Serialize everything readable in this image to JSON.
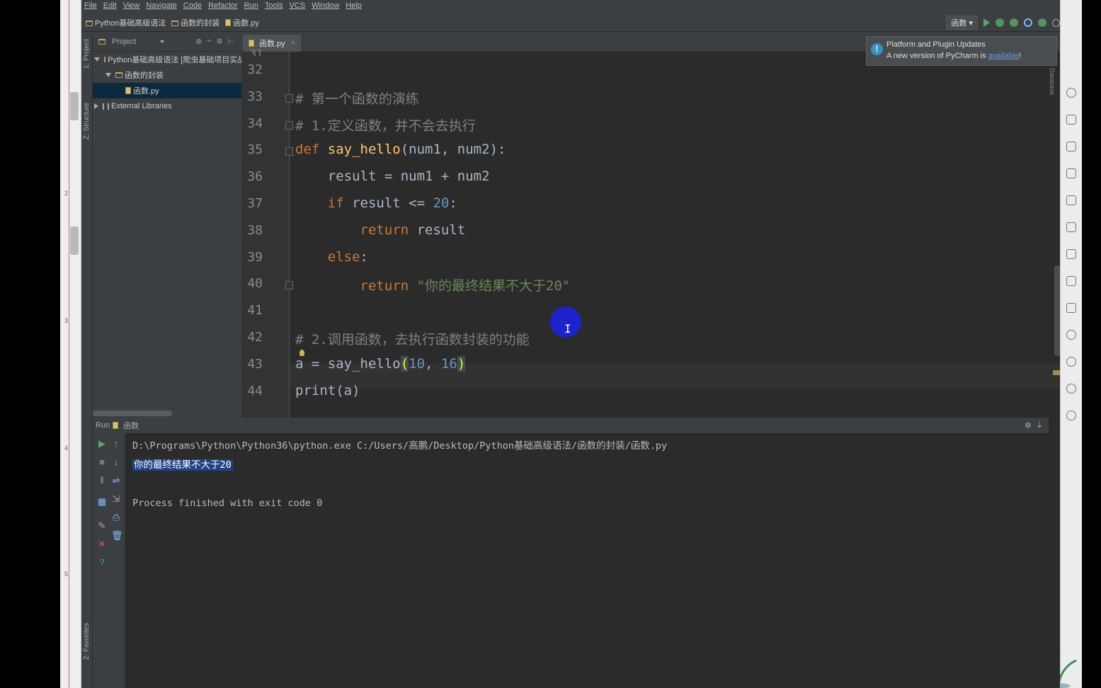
{
  "menu": [
    "File",
    "Edit",
    "View",
    "Navigate",
    "Code",
    "Refactor",
    "Run",
    "Tools",
    "VCS",
    "Window",
    "Help"
  ],
  "breadcrumb": [
    "Python基础高级语法",
    "函数的封装",
    "函数.py"
  ],
  "run_config": "函数",
  "left_strip_labels": [
    "1: Project",
    "Z: Structure",
    "2: Favorites"
  ],
  "project_panel": {
    "title": "Project",
    "tree": [
      {
        "label": "Python基础高级语法 [爬虫基础项目实战]",
        "level": 0,
        "type": "folder",
        "expanded": true
      },
      {
        "label": "函数的封装",
        "level": 1,
        "type": "folder",
        "expanded": true
      },
      {
        "label": "函数.py",
        "level": 2,
        "type": "file",
        "selected": true
      },
      {
        "label": "External Libraries",
        "level": 0,
        "type": "library",
        "expanded": false
      }
    ]
  },
  "editor": {
    "tab": "函数.py",
    "partial_top_line": "31",
    "lines": [
      {
        "n": "32",
        "html": ""
      },
      {
        "n": "33",
        "html": "<span class=\"cm\"># 第一个函数的演练</span>"
      },
      {
        "n": "34",
        "html": "<span class=\"cm\"># 1.定义函数，并不会去执行</span>"
      },
      {
        "n": "35",
        "html": "<span class=\"kw\">def</span> <span class=\"fn\">say_hello</span>(num1, num2):"
      },
      {
        "n": "36",
        "html": "    result = num1 + num2"
      },
      {
        "n": "37",
        "html": "    <span class=\"kw\">if</span> result &lt;= <span class=\"num\">20</span>:"
      },
      {
        "n": "38",
        "html": "        <span class=\"kw\">return</span> result"
      },
      {
        "n": "39",
        "html": "    <span class=\"kw\">else</span>:"
      },
      {
        "n": "40",
        "html": "        <span class=\"kw\">return</span> <span class=\"str\">\"你的最终结果不大于20\"</span>"
      },
      {
        "n": "41",
        "html": ""
      },
      {
        "n": "42",
        "html": "<span class=\"cm\"># 2.调用函数，去执行函数封装的功能</span>"
      },
      {
        "n": "43",
        "html": "a = say_hello<span class=\"paren-hl\">(</span><span class=\"num\">10</span>, <span class=\"num\">16</span><span class=\"paren-hl\">)</span>"
      },
      {
        "n": "44",
        "html": "print(a)"
      }
    ],
    "folds_at": [
      "33",
      "34",
      "35",
      "40"
    ]
  },
  "notification": {
    "title": "Platform and Plugin Updates",
    "text_prefix": "A new version of PyCharm is ",
    "link": "available",
    "text_suffix": "!"
  },
  "database_tab": "Database",
  "run_panel": {
    "label": "Run",
    "config": "函数",
    "console": [
      "D:\\Programs\\Python\\Python36\\python.exe C:/Users/高鹏/Desktop/Python基础高级语法/函数的封装/函数.py",
      "你的最终结果不大于20",
      "",
      "Process finished with exit code 0"
    ]
  },
  "left_strip_numbers": [
    "2",
    "3",
    "4",
    "5"
  ],
  "colors": {
    "keyword": "#cc7832",
    "function": "#ffc66d",
    "number": "#6897bb",
    "string": "#6a8759",
    "comment": "#808080"
  }
}
